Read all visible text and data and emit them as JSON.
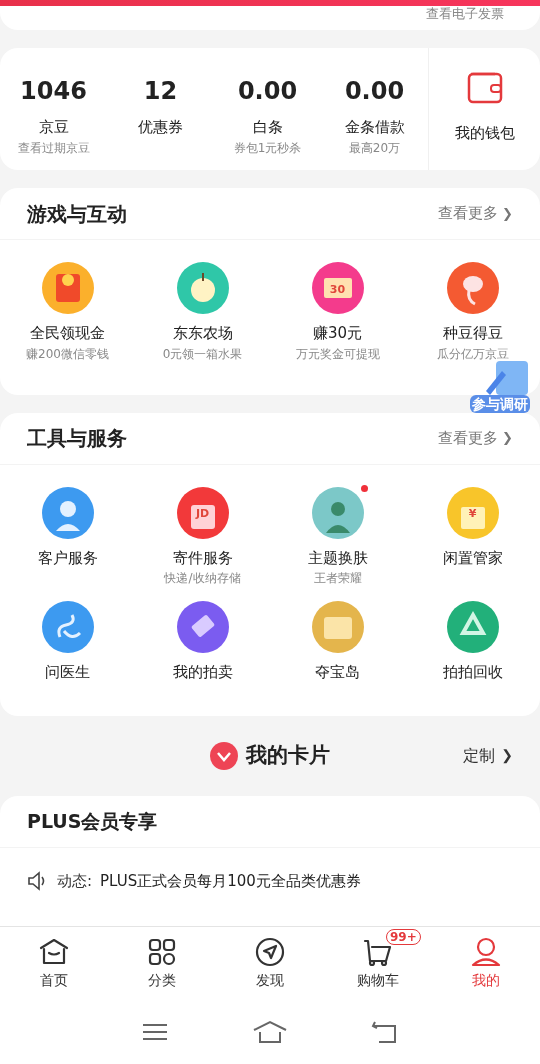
{
  "invoice_link": "查看电子发票",
  "assets": [
    {
      "value": "1046",
      "label": "京豆",
      "sub": "查看过期京豆"
    },
    {
      "value": "12",
      "label": "优惠券"
    },
    {
      "value": "0.00",
      "label": "白条",
      "sub": "券包1元秒杀"
    },
    {
      "value": "0.00",
      "label": "金条借款",
      "sub": "最高20万"
    }
  ],
  "wallet": {
    "label": "我的钱包"
  },
  "games": {
    "title": "游戏与互动",
    "more": "查看更多",
    "chevron": "❯",
    "items": [
      {
        "kind": "redpacket",
        "label": "全民领现金",
        "sub": "赚200微信零钱",
        "color": "#fbb02c"
      },
      {
        "kind": "apple",
        "label": "东东农场",
        "sub": "0元领一箱水果",
        "color": "#2fc7a8"
      },
      {
        "kind": "ticket",
        "label": "赚30元",
        "sub": "万元奖金可提现",
        "color": "#f43b8c",
        "icon_text": "30"
      },
      {
        "kind": "sprout",
        "label": "种豆得豆",
        "sub": "瓜分亿万京豆",
        "color": "#f45a32"
      }
    ]
  },
  "survey_badge": "参与调研",
  "tools": {
    "title": "工具与服务",
    "more": "查看更多",
    "chevron": "❯",
    "items": [
      {
        "kind": "headset",
        "label": "客户服务",
        "color": "#3d9af0",
        "dot": false
      },
      {
        "kind": "box",
        "label": "寄件服务",
        "sub": "快递/收纳存储",
        "color": "#f2393a",
        "dot": false,
        "icon_text": "JD"
      },
      {
        "kind": "avatar",
        "label": "主题换肤",
        "sub": "王者荣耀",
        "color": "#7cc8c8",
        "dot": true
      },
      {
        "kind": "chest",
        "label": "闲置管家",
        "color": "#f8c52a",
        "dot": false,
        "icon_text": "¥"
      },
      {
        "kind": "knot",
        "label": "问医生",
        "color": "#3d9af0",
        "dot": false
      },
      {
        "kind": "gavel",
        "label": "我的拍卖",
        "color": "#7b5cf0",
        "dot": false
      },
      {
        "kind": "treasure",
        "label": "夺宝岛",
        "color": "#e4b54c",
        "dot": false
      },
      {
        "kind": "recycle",
        "label": "拍拍回收",
        "color": "#22b07a",
        "dot": false
      }
    ]
  },
  "cards": {
    "title": "我的卡片",
    "customize": "定制",
    "chevron": "❯"
  },
  "plus": {
    "title": "PLUS会员专享",
    "news_label": "动态:",
    "news": "PLUS正式会员每月100元全品类优惠券"
  },
  "tabbar": [
    {
      "kind": "home",
      "label": "首页",
      "selected": false
    },
    {
      "kind": "grid",
      "label": "分类",
      "selected": false
    },
    {
      "kind": "compass",
      "label": "发现",
      "selected": false
    },
    {
      "kind": "cart",
      "label": "购物车",
      "selected": false,
      "badge": "99+"
    },
    {
      "kind": "user",
      "label": "我的",
      "selected": true
    }
  ]
}
